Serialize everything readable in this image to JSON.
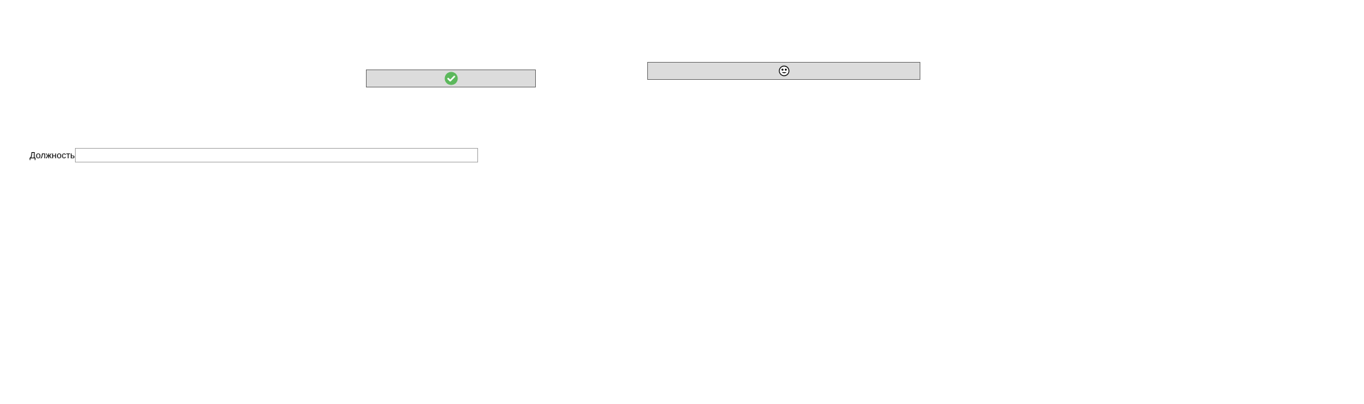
{
  "buttons": {
    "confirm": {
      "icon": "check-circle-icon",
      "icon_color": "#5cb85c"
    },
    "secondary": {
      "icon": "smiley-face-icon"
    }
  },
  "form": {
    "position_label": "Должность",
    "position_value": "",
    "position_placeholder": ""
  },
  "colors": {
    "button_bg": "#dcdcdc",
    "button_border": "#707070",
    "input_border": "#a9a9a9"
  }
}
